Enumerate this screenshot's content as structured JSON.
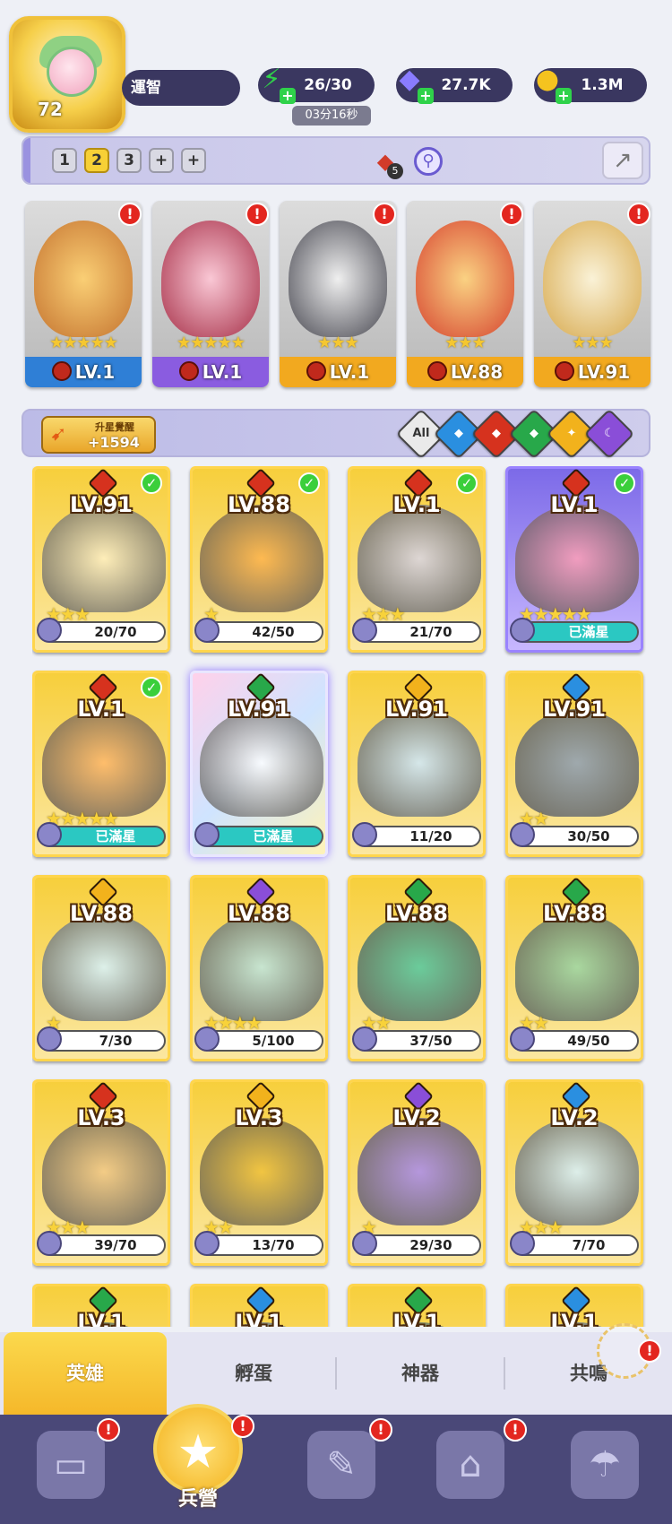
{
  "player": {
    "level": "72",
    "name": "運智"
  },
  "resources": {
    "energy": {
      "value": "26/30",
      "timer": "03分16秒",
      "icon": "lightning-icon"
    },
    "gems": {
      "value": "27.7K",
      "icon": "diamond-icon"
    },
    "coins": {
      "value": "1.3M",
      "icon": "coin-icon"
    }
  },
  "team_bar": {
    "slots": [
      "1",
      "2",
      "3",
      "+",
      "+"
    ],
    "selected": "2",
    "fire_count": "5"
  },
  "team": [
    {
      "level": "LV.1",
      "stars": "★★★★★",
      "color": "#2f7fd6"
    },
    {
      "level": "LV.1",
      "stars": "★★★★★",
      "color": "#8a5ce0"
    },
    {
      "level": "LV.1",
      "stars": "★★★",
      "color": "#f2a91f"
    },
    {
      "level": "LV.88",
      "stars": "★★★",
      "color": "#f2a91f"
    },
    {
      "level": "LV.91",
      "stars": "★★★",
      "color": "#f2a91f"
    }
  ],
  "filter": {
    "upgrade_label": "升星覺醒",
    "upgrade_value": "+1594",
    "all_label": "All",
    "elements": [
      {
        "name": "water",
        "color": "#2a8fe0"
      },
      {
        "name": "fire",
        "color": "#d6321e"
      },
      {
        "name": "nature",
        "color": "#28a84a"
      },
      {
        "name": "light",
        "color": "#f2b21c"
      },
      {
        "name": "dark",
        "color": "#8a4ed8"
      }
    ]
  },
  "heroes": [
    {
      "level": "LV.91",
      "progress": "20/70",
      "stars": "★★★",
      "element": "#d6321e",
      "check": true
    },
    {
      "level": "LV.88",
      "progress": "42/50",
      "stars": "★",
      "element": "#d6321e",
      "check": true
    },
    {
      "level": "LV.1",
      "progress": "21/70",
      "stars": "★★★",
      "element": "#d6321e",
      "check": true
    },
    {
      "level": "LV.1",
      "progress": "已滿星",
      "stars": "★★★★★",
      "element": "#d6321e",
      "check": true
    },
    {
      "level": "LV.1",
      "progress": "已滿星",
      "stars": "★★★★★",
      "element": "#d6321e",
      "check": true
    },
    {
      "level": "LV.91",
      "progress": "已滿星",
      "stars": "",
      "element": "#28a84a",
      "check": false
    },
    {
      "level": "LV.91",
      "progress": "11/20",
      "stars": "",
      "element": "#f2b21c",
      "check": false
    },
    {
      "level": "LV.91",
      "progress": "30/50",
      "stars": "★★",
      "element": "#2a8fe0",
      "check": false
    },
    {
      "level": "LV.88",
      "progress": "7/30",
      "stars": "★",
      "element": "#f2b21c",
      "check": false
    },
    {
      "level": "LV.88",
      "progress": "5/100",
      "stars": "★★★★",
      "element": "#8a4ed8",
      "check": false
    },
    {
      "level": "LV.88",
      "progress": "37/50",
      "stars": "★★",
      "element": "#28a84a",
      "check": false
    },
    {
      "level": "LV.88",
      "progress": "49/50",
      "stars": "★★",
      "element": "#28a84a",
      "check": false
    },
    {
      "level": "LV.3",
      "progress": "39/70",
      "stars": "★★★",
      "element": "#d6321e",
      "check": false
    },
    {
      "level": "LV.3",
      "progress": "13/70",
      "stars": "★★",
      "element": "#f2b21c",
      "check": false
    },
    {
      "level": "LV.2",
      "progress": "29/30",
      "stars": "★",
      "element": "#8a4ed8",
      "check": false
    },
    {
      "level": "LV.2",
      "progress": "7/70",
      "stars": "★★★",
      "element": "#2a8fe0",
      "check": false
    },
    {
      "level": "LV.1",
      "progress": "",
      "stars": "",
      "element": "#28a84a",
      "check": false
    },
    {
      "level": "LV.1",
      "progress": "",
      "stars": "",
      "element": "#2a8fe0",
      "check": false
    },
    {
      "level": "LV.1",
      "progress": "",
      "stars": "",
      "element": "#28a84a",
      "check": false
    },
    {
      "level": "LV.1",
      "progress": "",
      "stars": "",
      "element": "#2a8fe0",
      "check": false
    }
  ],
  "tabs": [
    "英雄",
    "孵蛋",
    "神器",
    "共鳴"
  ],
  "bottom_nav": [
    {
      "label": "",
      "icon": "cards-icon"
    },
    {
      "label": "兵營",
      "icon": "barracks-icon"
    },
    {
      "label": "",
      "icon": "map-icon"
    },
    {
      "label": "",
      "icon": "castle-icon"
    },
    {
      "label": "",
      "icon": "guild-icon"
    }
  ]
}
